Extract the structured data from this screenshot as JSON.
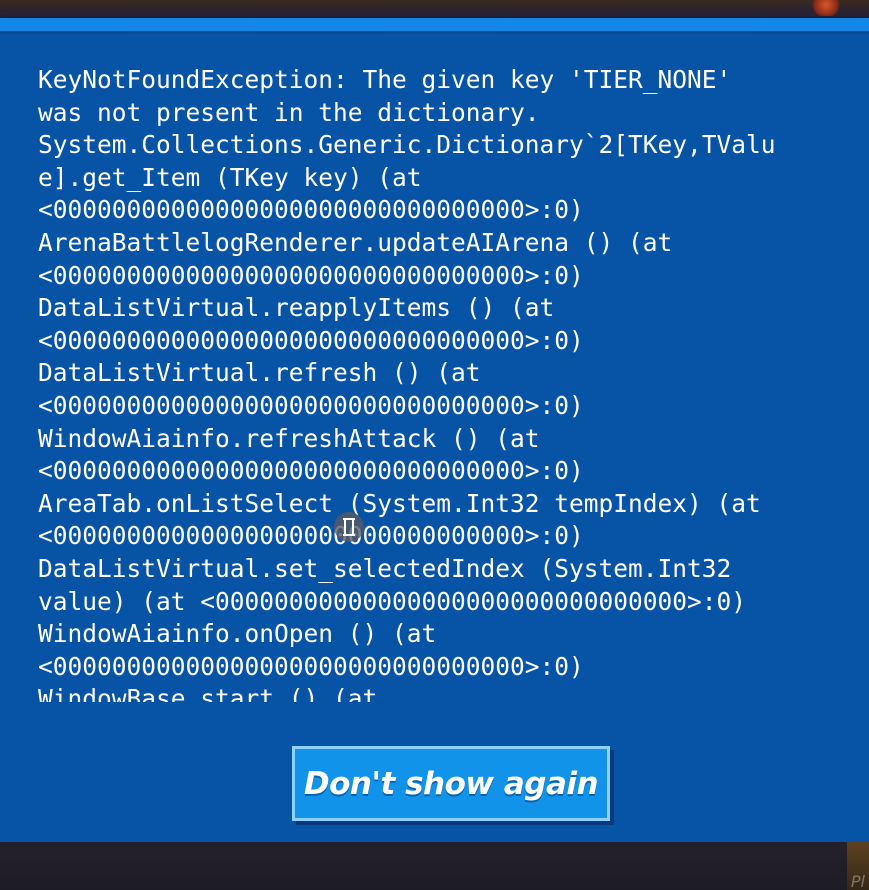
{
  "error_dialog": {
    "log_lines": [
      "KeyNotFoundException: The given key 'TIER_NONE'",
      "was not present in the dictionary.",
      "System.Collections.Generic.Dictionary`2[TKey,TValu",
      "e].get_Item (TKey key) (at",
      "<00000000000000000000000000000000>:0)",
      "ArenaBattlelogRenderer.updateAIArena () (at",
      "<00000000000000000000000000000000>:0)",
      "DataListVirtual.reapplyItems () (at",
      "<00000000000000000000000000000000>:0)",
      "DataListVirtual.refresh () (at",
      "<00000000000000000000000000000000>:0)",
      "WindowAiainfo.refreshAttack () (at",
      "<00000000000000000000000000000000>:0)",
      "AreaTab.onListSelect (System.Int32 tempIndex) (at",
      "<00000000000000000000000000000000>:0)",
      "DataListVirtual.set_selectedIndex (System.Int32",
      "value) (at <00000000000000000000000000000000>:0)",
      "WindowAiainfo.onOpen () (at",
      "<00000000000000000000000000000000>:0)",
      "WindowBase.start () (at"
    ],
    "dont_show_again_label": "Don't show again"
  },
  "background": {
    "corner_text": "Pl"
  },
  "colors": {
    "dialog_bg": "#0753a6",
    "dialog_topbar": "#1486e6",
    "button_bg": "#1193ea",
    "button_border": "#8fd2ff",
    "text": "#ffffff"
  },
  "icons": {
    "text_cursor": "text-cursor-icon"
  }
}
